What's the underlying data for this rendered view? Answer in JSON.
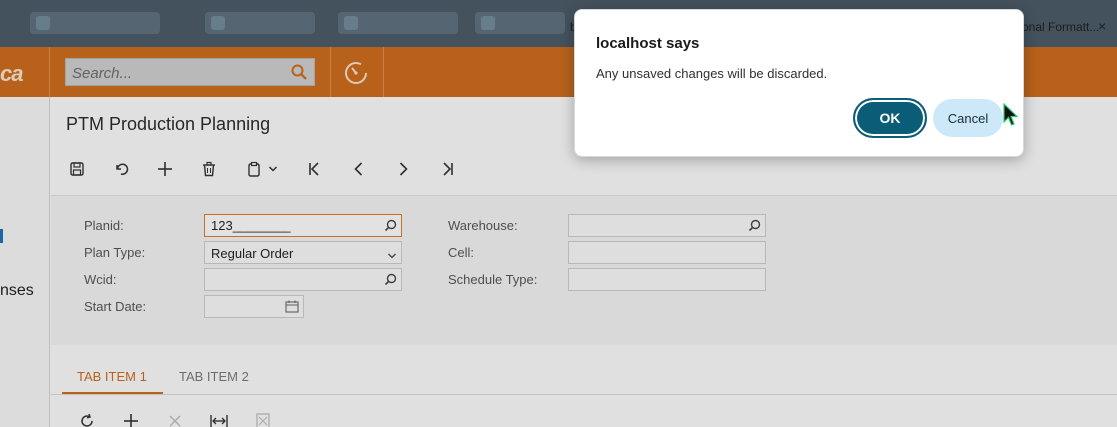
{
  "browser": {
    "tab_partial_left": "b",
    "tab_partial_right": "onal Formatt...",
    "tab_close": "×"
  },
  "header": {
    "logo_partial": "ca",
    "search_placeholder": "Search..."
  },
  "left_nav": {
    "partial_item": "nses"
  },
  "page": {
    "title": "PTM Production Planning"
  },
  "form": {
    "planid_label": "Planid:",
    "planid_value": "123________",
    "plan_type_label": "Plan Type:",
    "plan_type_value": "Regular Order",
    "wcid_label": "Wcid:",
    "wcid_value": "",
    "start_date_label": "Start Date:",
    "start_date_value": "",
    "warehouse_label": "Warehouse:",
    "warehouse_value": "",
    "cell_label": "Cell:",
    "cell_value": "",
    "schedule_type_label": "Schedule Type:",
    "schedule_type_value": ""
  },
  "tabs": [
    {
      "label": "TAB ITEM 1",
      "active": true
    },
    {
      "label": "TAB ITEM 2",
      "active": false
    }
  ],
  "dialog": {
    "title": "localhost says",
    "message": "Any unsaved changes will be discarded.",
    "ok_label": "OK",
    "cancel_label": "Cancel"
  },
  "colors": {
    "header_orange": "#c76a1e",
    "dialog_ok": "#0b5c76",
    "dialog_cancel": "#cde9f9",
    "focus_border": "#d47a2c"
  },
  "icons": {
    "toolbar": [
      "save-icon",
      "undo-icon",
      "add-icon",
      "delete-icon",
      "clipboard-icon",
      "first-page-icon",
      "previous-icon",
      "next-icon",
      "last-page-icon"
    ],
    "grid_toolbar": [
      "refresh-icon",
      "add-icon",
      "remove-icon",
      "fit-columns-icon",
      "export-icon"
    ]
  }
}
